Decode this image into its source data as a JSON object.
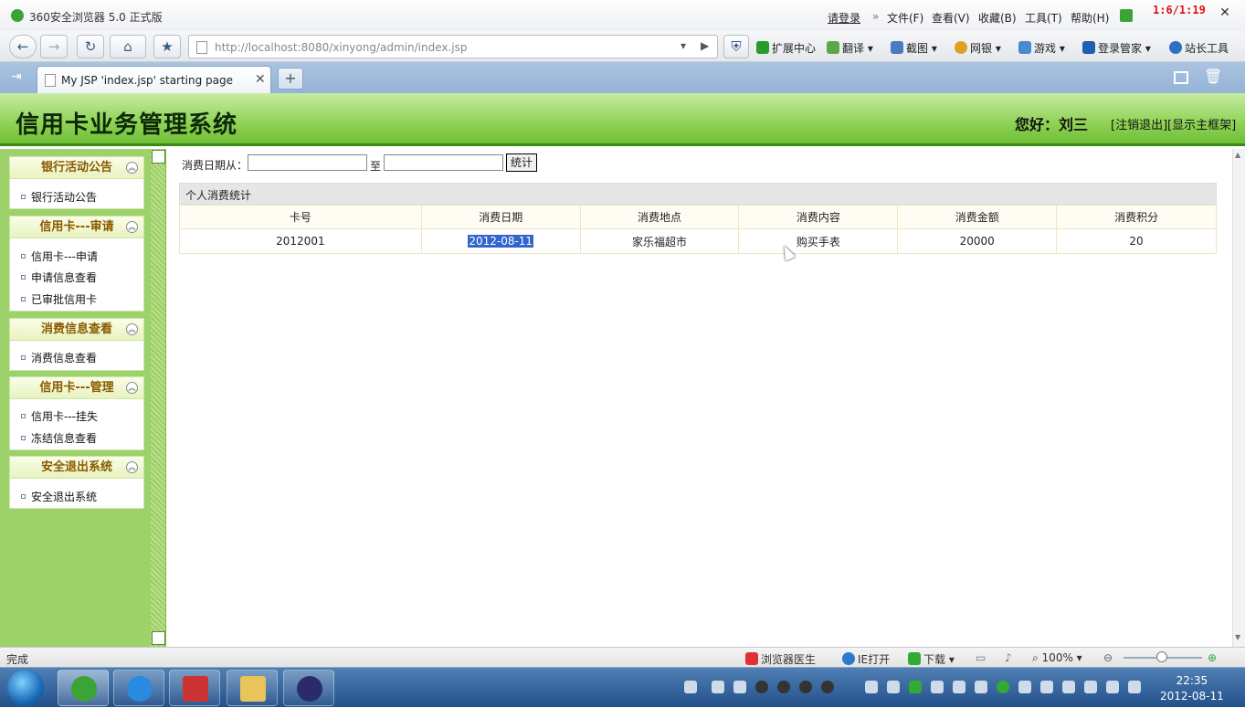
{
  "browser": {
    "title": "360安全浏览器 5.0 正式版",
    "login": "请登录",
    "menus": [
      "文件(F)",
      "查看(V)",
      "收藏(B)",
      "工具(T)",
      "帮助(H)"
    ],
    "counter": "1:6/1:19",
    "url": "http://localhost:8080/xinyong/admin/index.jsp",
    "tools": [
      "扩展中心",
      "翻译",
      "截图",
      "网银",
      "游戏",
      "登录管家",
      "站长工具"
    ],
    "tab_title": "My JSP 'index.jsp' starting page"
  },
  "app": {
    "title": "信用卡业务管理系统",
    "greeting": "您好：刘三",
    "logout": "[注销退出]",
    "show_frame": "[显示主框架]"
  },
  "sidebar": {
    "groups": [
      {
        "title": "银行活动公告",
        "items": [
          "银行活动公告"
        ]
      },
      {
        "title": "信用卡---审请",
        "items": [
          "信用卡---申请",
          "申请信息查看",
          "已审批信用卡"
        ]
      },
      {
        "title": "消费信息查看",
        "items": [
          "消费信息查看"
        ]
      },
      {
        "title": "信用卡---管理",
        "items": [
          "信用卡---挂失",
          "冻结信息查看"
        ]
      },
      {
        "title": "安全退出系统",
        "items": [
          "安全退出系统"
        ]
      }
    ]
  },
  "filter": {
    "from_label": "消费日期从：",
    "to_label": "至",
    "submit": "统计",
    "from_value": "",
    "to_value": ""
  },
  "table": {
    "caption": "个人消费统计",
    "headers": [
      "卡号",
      "消费日期",
      "消费地点",
      "消费内容",
      "消费金额",
      "消费积分"
    ],
    "rows": [
      [
        "2012001",
        "2012-08-11",
        "家乐福超市",
        "购买手表",
        "20000",
        "20"
      ]
    ]
  },
  "statusbar": {
    "status": "完成",
    "items": [
      "浏览器医生",
      "IE打开",
      "下载"
    ],
    "zoom": "100%"
  },
  "taskbar": {
    "time": "22:35",
    "date": "2012-08-11"
  }
}
